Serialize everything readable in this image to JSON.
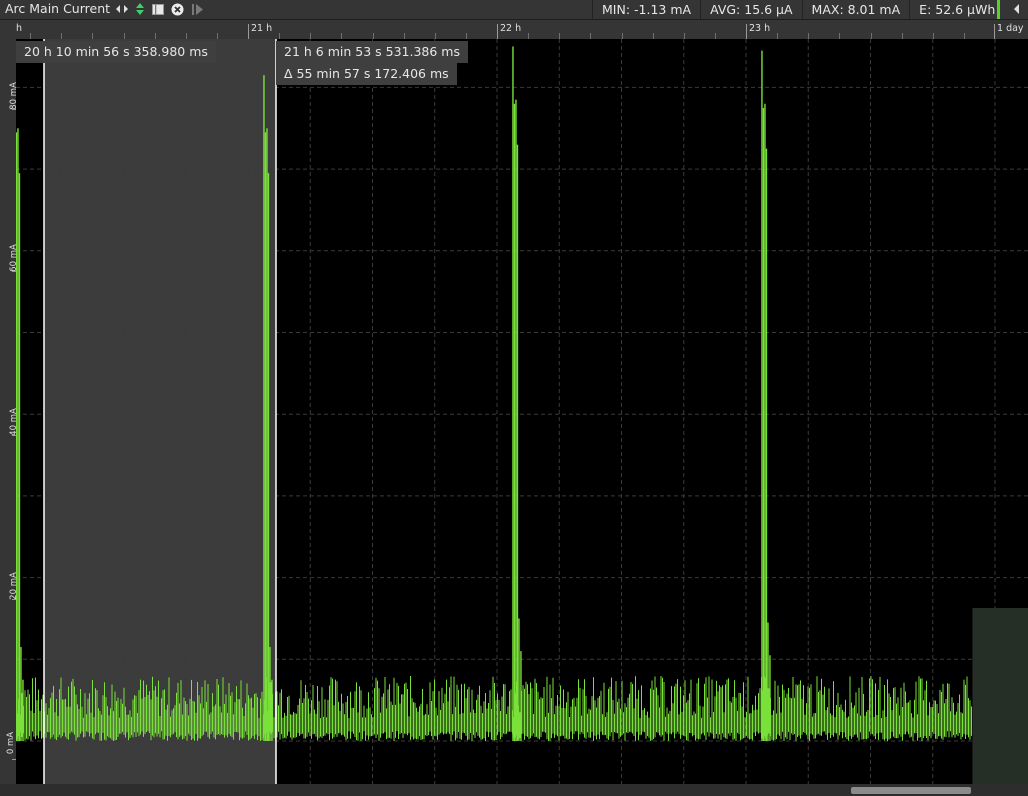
{
  "toolbar": {
    "title": "Arc Main Current",
    "icons": [
      "left-right-arrows-icon",
      "up-down-arrows-icon",
      "stop-square-icon",
      "close-circle-icon",
      "play-end-icon"
    ]
  },
  "stats": {
    "min": "MIN: -1.13 mA",
    "avg": "AVG: 15.6 µA",
    "max": "MAX: 8.01 mA",
    "energy": "E: 52.6 µWh"
  },
  "time_axis": {
    "labels": [
      "h",
      "21 h",
      "22 h",
      "23 h",
      "1 day"
    ]
  },
  "value_axis": {
    "labels": [
      "80 mA",
      "60 mA",
      "40 mA",
      "20 mA",
      "0 mA"
    ]
  },
  "cursors": {
    "left_time": "20 h 10 min 56 s 358.980 ms",
    "right_time": "21 h 6 min 53 s 531.386 ms",
    "delta": "Δ 55 min 57 s 172.406 ms"
  },
  "colors": {
    "trace": "#7ae03a",
    "background": "#000000",
    "selection": "#3c3c3c",
    "grid": "#3a3a3a"
  },
  "chart_data": {
    "type": "line",
    "series": [
      {
        "x_hours": [
          20.04,
          21.04,
          22.04,
          23.04
        ],
        "peak_mA": [
          81.5,
          81.5,
          85.0,
          84.5
        ]
      }
    ],
    "baseline_mA": [
      0,
      8
    ],
    "x_range_hours": [
      20.0,
      24.0
    ],
    "y_range_mA": [
      -2,
      90
    ],
    "grid": true
  }
}
